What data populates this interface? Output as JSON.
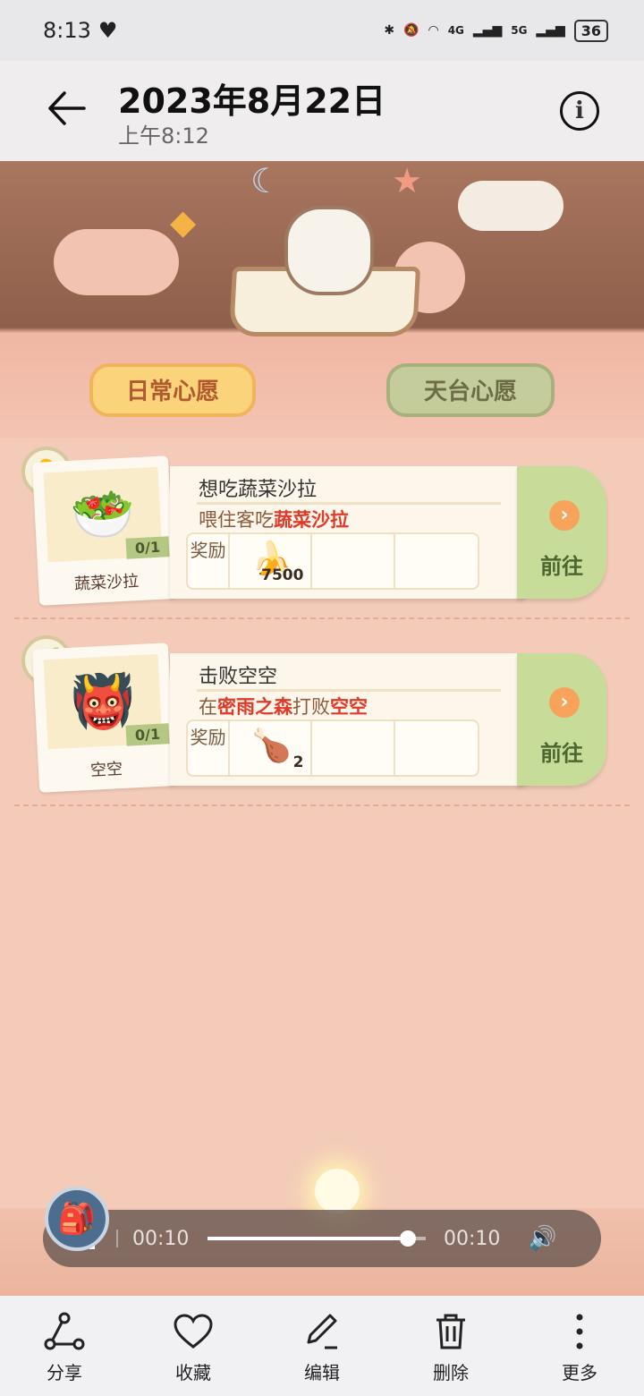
{
  "status_bar": {
    "time": "8:13",
    "network_4g": "4G",
    "network_5g": "5G",
    "battery": "36"
  },
  "header": {
    "title": "2023年8月22日",
    "subtitle": "上午8:12"
  },
  "tabs": {
    "daily": "日常心愿",
    "rooftop": "天台心愿"
  },
  "quests": [
    {
      "card_name": "蔬菜沙拉",
      "progress": "0/1",
      "title": "想吃蔬菜沙拉",
      "desc_prefix": "喂住客吃",
      "desc_hl1": "蔬菜沙拉",
      "reward_label": "奖励",
      "reward_icon": "banana-icon",
      "reward_qty": "7500",
      "go_label": "前往"
    },
    {
      "card_name": "空空",
      "progress": "0/1",
      "title": "击败空空",
      "desc_prefix": "在",
      "desc_hl1": "密雨之森",
      "desc_mid": "打败",
      "desc_hl2": "空空",
      "reward_label": "奖励",
      "reward_icon": "paw-drumstick-icon",
      "reward_qty": "2",
      "go_label": "前往"
    }
  ],
  "player": {
    "current_time": "00:10",
    "total_time": "00:10",
    "progress": 0.92
  },
  "toolbar": {
    "share": "分享",
    "favorite": "收藏",
    "edit": "编辑",
    "delete": "删除",
    "more": "更多"
  },
  "colors": {
    "highlight": "#e03a2a",
    "go_button": "#c7dc98",
    "background": "#f3cbb8"
  }
}
